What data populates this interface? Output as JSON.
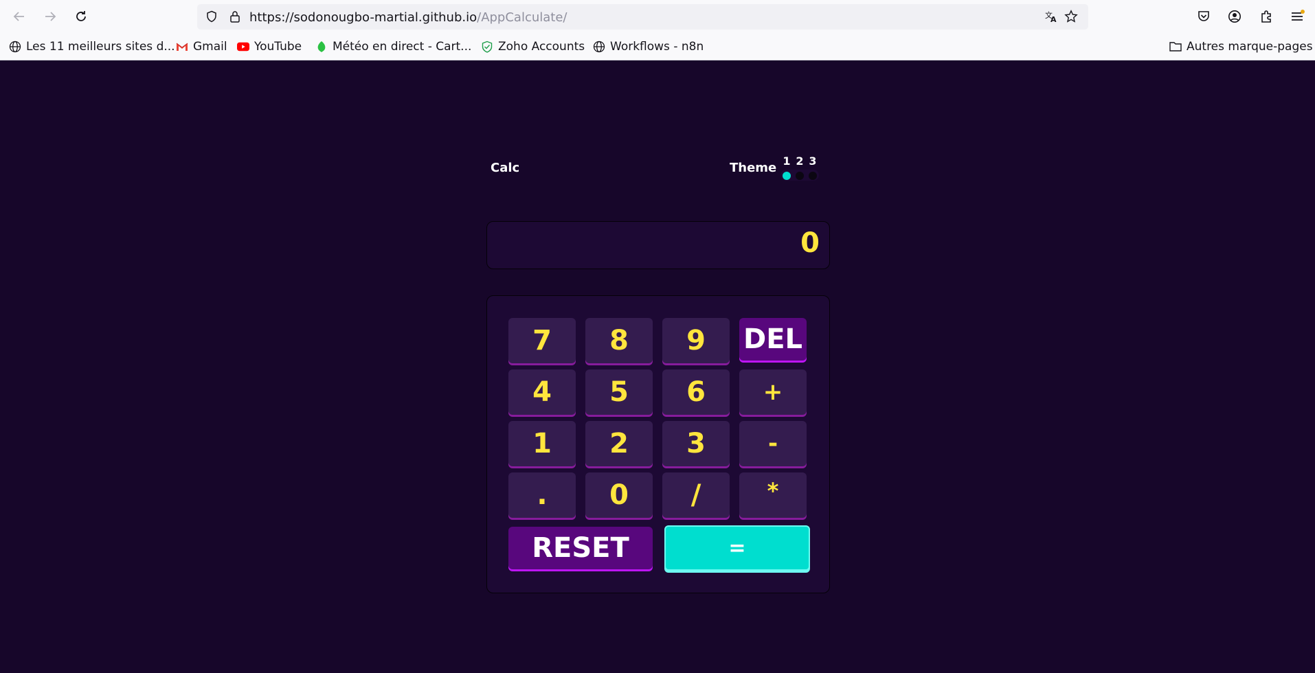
{
  "browser": {
    "url_domain": "https://sodonougbo-martial.github.io",
    "url_path": "/AppCalculate/",
    "bookmarks": [
      {
        "label": "Les 11 meilleurs sites d...",
        "icon": "globe-icon"
      },
      {
        "label": "Gmail",
        "icon": "gmail-icon"
      },
      {
        "label": "YouTube",
        "icon": "youtube-icon"
      },
      {
        "label": "Météo en direct - Cart...",
        "icon": "leaf-icon"
      },
      {
        "label": "Zoho Accounts",
        "icon": "zoho-icon"
      },
      {
        "label": "Workflows - n8n",
        "icon": "globe-icon"
      }
    ],
    "other_bookmarks": "Autres marque-pages"
  },
  "app": {
    "title": "Calc",
    "theme_label": "Theme",
    "theme_options": [
      "1",
      "2",
      "3"
    ],
    "active_theme": "1",
    "display_value": "0",
    "keys": [
      "7",
      "8",
      "9",
      "DEL",
      "4",
      "5",
      "6",
      "+",
      "1",
      "2",
      "3",
      "-",
      ".",
      "0",
      "/",
      "*"
    ],
    "reset_label": "RESET",
    "equals_label": "=",
    "colors": {
      "background": "#17062a",
      "panel": "#1d0934",
      "key": "#341c4f",
      "key_text": "#ffe53d",
      "key_dark": "#58077d",
      "accent": "#00decf"
    }
  }
}
